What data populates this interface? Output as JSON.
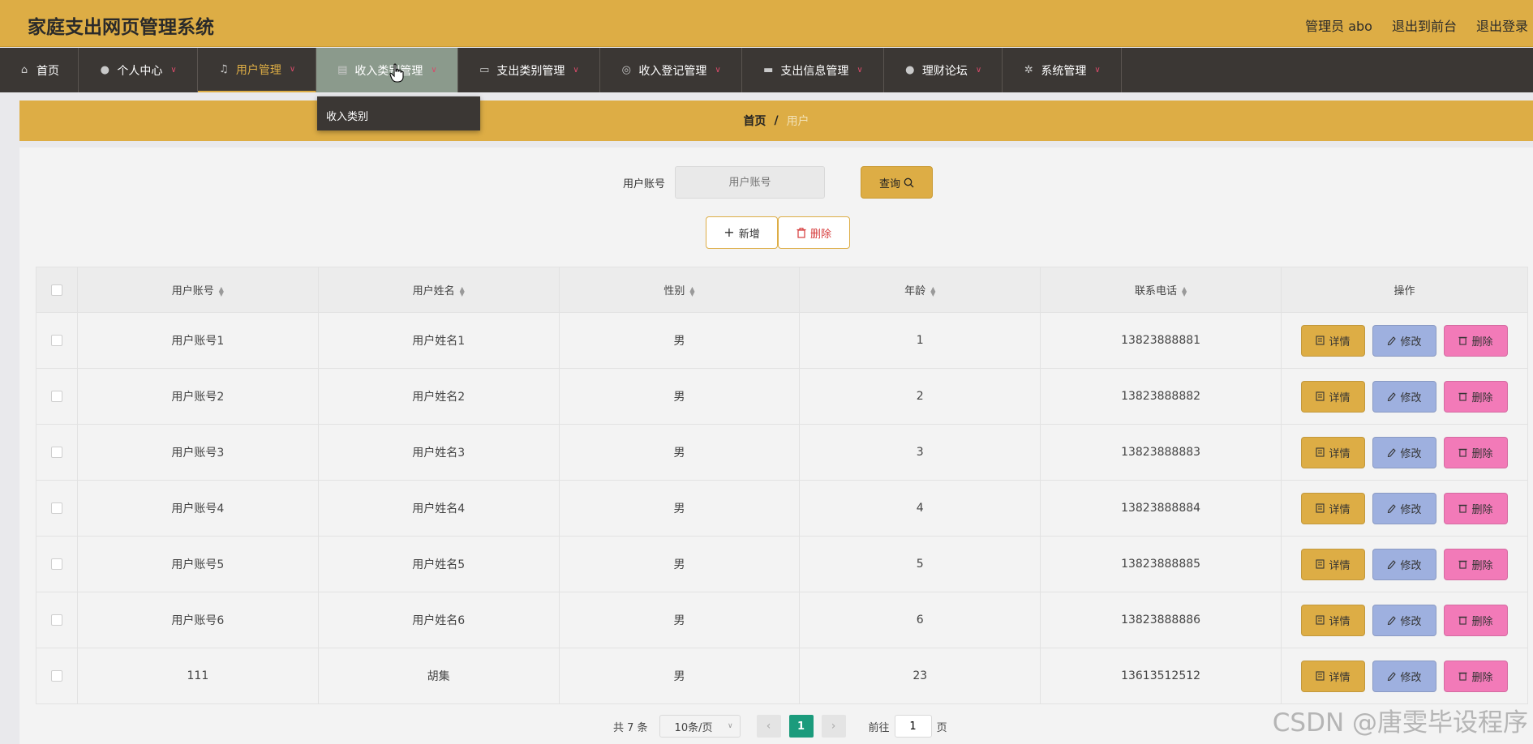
{
  "app": {
    "title": "家庭支出网页管理系统",
    "top_links": [
      "管理员 abo",
      "退出到前台",
      "退出登录"
    ]
  },
  "nav": {
    "items": [
      {
        "label": "首页",
        "icon": "home-icon",
        "width": 97,
        "chev": false
      },
      {
        "label": "个人中心",
        "icon": "user-icon",
        "width": 147,
        "chev": true
      },
      {
        "label": "用户管理",
        "icon": "bell-icon",
        "width": 146,
        "chev": true
      },
      {
        "label": "收入类别管理",
        "icon": "monitor-icon",
        "width": 175,
        "chev": true
      },
      {
        "label": "支出类别管理",
        "icon": "card-icon",
        "width": 175,
        "chev": true
      },
      {
        "label": "收入登记管理",
        "icon": "compass-icon",
        "width": 175,
        "chev": true
      },
      {
        "label": "支出信息管理",
        "icon": "display-icon",
        "width": 175,
        "chev": true
      },
      {
        "label": "理财论坛",
        "icon": "pin-icon",
        "width": 146,
        "chev": true
      },
      {
        "label": "系统管理",
        "icon": "gear-icon",
        "width": 147,
        "chev": true
      }
    ],
    "dropdown_item": "收入类别"
  },
  "breadcrumb": {
    "home": "首页",
    "sep": "/",
    "current": "用户"
  },
  "search": {
    "label": "用户账号",
    "placeholder": "用户账号",
    "button": "查询"
  },
  "actions": {
    "add": "新增",
    "delete": "删除"
  },
  "table": {
    "headers": [
      "用户账号",
      "用户姓名",
      "性别",
      "年龄",
      "联系电话",
      "操作"
    ],
    "rows": [
      {
        "account": "用户账号1",
        "name": "用户姓名1",
        "gender": "男",
        "age": "1",
        "phone": "13823888881"
      },
      {
        "account": "用户账号2",
        "name": "用户姓名2",
        "gender": "男",
        "age": "2",
        "phone": "13823888882"
      },
      {
        "account": "用户账号3",
        "name": "用户姓名3",
        "gender": "男",
        "age": "3",
        "phone": "13823888883"
      },
      {
        "account": "用户账号4",
        "name": "用户姓名4",
        "gender": "男",
        "age": "4",
        "phone": "13823888884"
      },
      {
        "account": "用户账号5",
        "name": "用户姓名5",
        "gender": "男",
        "age": "5",
        "phone": "13823888885"
      },
      {
        "account": "用户账号6",
        "name": "用户姓名6",
        "gender": "男",
        "age": "6",
        "phone": "13823888886"
      },
      {
        "account": "111",
        "name": "胡集",
        "gender": "男",
        "age": "23",
        "phone": "13613512512"
      }
    ],
    "op_labels": {
      "detail": "详情",
      "edit": "修改",
      "delete": "删除"
    }
  },
  "pagination": {
    "total": "共 7 条",
    "page_size": "10条/页",
    "current": "1",
    "goto_prefix": "前往",
    "goto_value": "1",
    "goto_suffix": "页"
  },
  "watermark": "CSDN @唐雯毕设程序",
  "colors": {
    "accent": "#ddad45",
    "nav_bg": "#3b3734",
    "pager_active": "#1b9b7c",
    "edit": "#9eb0df",
    "delete": "#f27ab8"
  }
}
